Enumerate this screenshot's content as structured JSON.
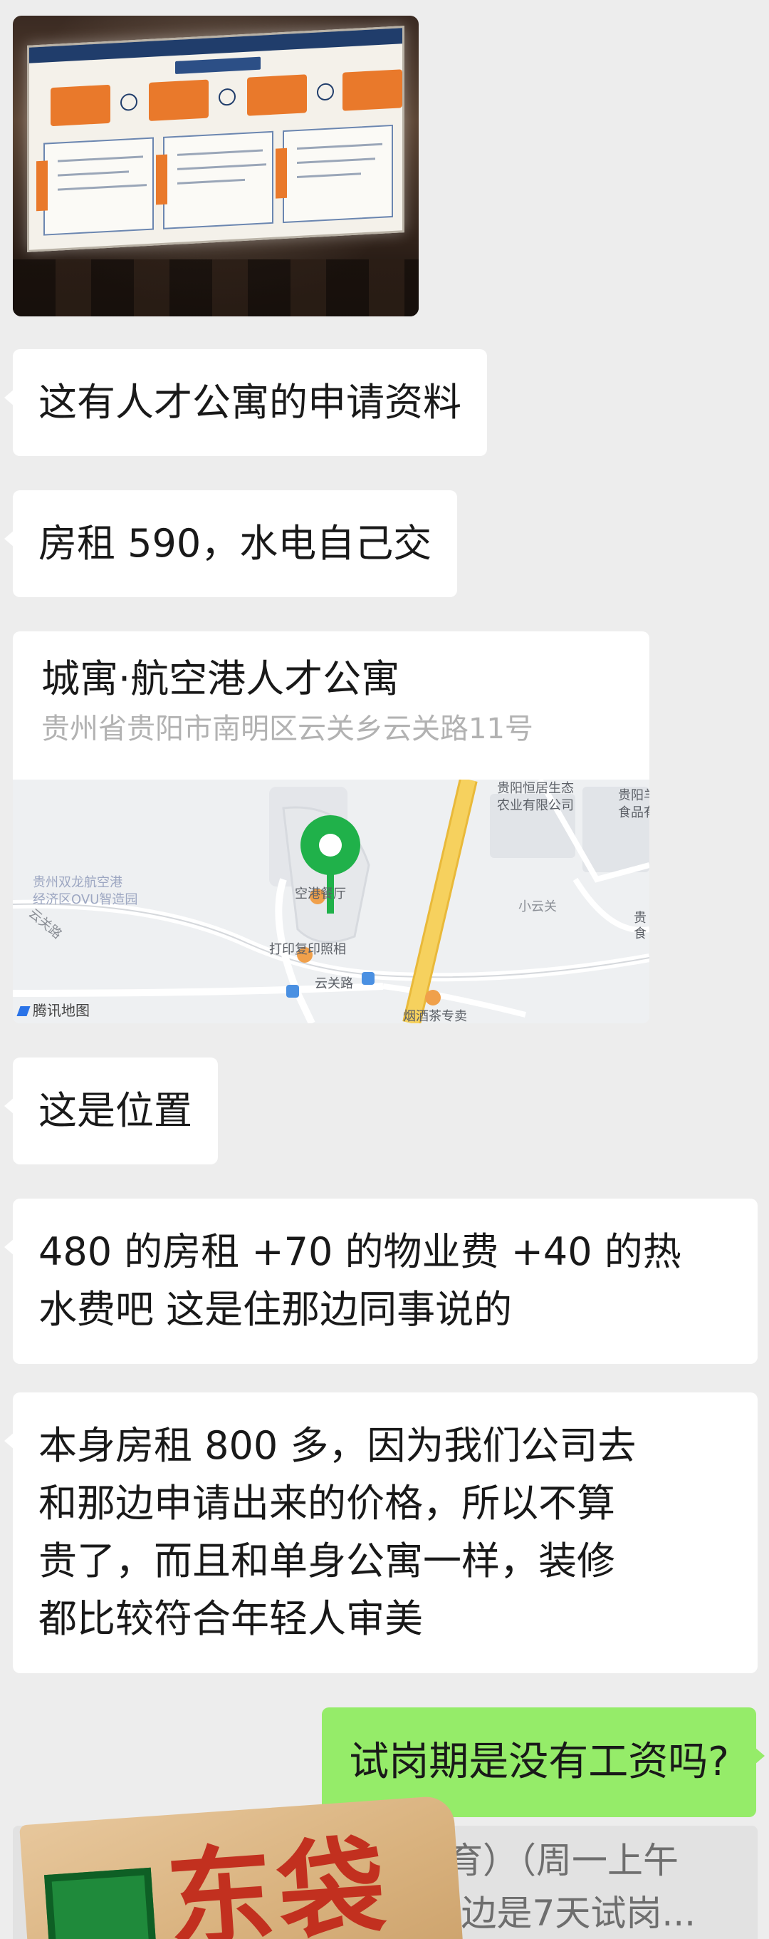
{
  "messages": [
    {
      "type": "image",
      "sender": "other",
      "description_icon": "photo"
    },
    {
      "type": "text",
      "sender": "other",
      "text": "这有人才公寓的申请资料"
    },
    {
      "type": "text",
      "sender": "other",
      "text": "房租 590，水电自己交"
    },
    {
      "type": "location",
      "sender": "other",
      "title": "城寓·航空港人才公寓",
      "address": "贵州省贵阳市南明区云关乡云关路11号"
    },
    {
      "type": "text",
      "sender": "other",
      "text": "这是位置"
    },
    {
      "type": "text",
      "sender": "other",
      "lines": [
        "480 的房租 +70 的物业费 +40 的热",
        "水费吧  这是住那边同事说的"
      ]
    },
    {
      "type": "text",
      "sender": "other",
      "lines": [
        "本身房租 800 多，因为我们公司去",
        "和那边申请出来的价格，所以不算",
        "贵了，而且和单身公寓一样，装修",
        "都比较符合年轻人审美"
      ]
    },
    {
      "type": "text",
      "sender": "me",
      "text": "试岗期是没有工资吗?"
    }
  ],
  "map": {
    "provider": "腾讯地图",
    "labels": {
      "park": "贵州双龙航空港",
      "park2": "经济区OVU智造园",
      "company": "贵阳恒居生态",
      "company2": "农业有限公司",
      "food": "贵阳羊",
      "food2": "食品有",
      "restaurant": "空港餐厅",
      "print": "打印复印照相",
      "road": "云关路",
      "road2": "云关路",
      "village": "小云关",
      "shop": "烟酒茶专卖",
      "edge": "贵",
      "edge2": "食"
    },
    "colors": {
      "road_main": "#f2c94c",
      "pin": "#1aad19",
      "poi": "#f0a04b",
      "bus": "#4a90e2"
    }
  },
  "quote": {
    "line1": "教育）（周一上午",
    "line2": "]这边是7天试岗..."
  },
  "watermark": {
    "text": "东袋"
  },
  "colors": {
    "bg": "#ededed",
    "bubble_other": "#ffffff",
    "bubble_me": "#95ec69"
  }
}
